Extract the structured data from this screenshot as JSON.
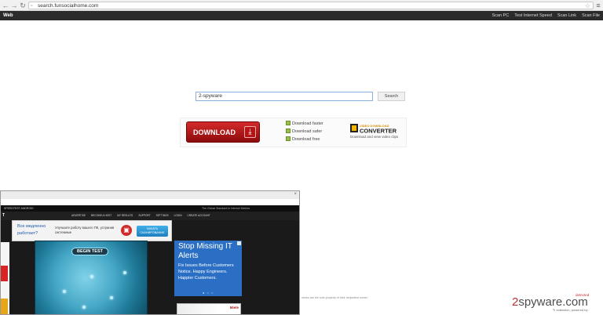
{
  "browser": {
    "url": "search.funsocialhome.com",
    "back_icon": "back-arrow-icon",
    "forward_icon": "forward-arrow-icon",
    "reload_icon": "reload-icon",
    "star_icon": "star-icon",
    "menu_icon": "menu-icon"
  },
  "header": {
    "brand": "Web",
    "links": [
      "Scan PC",
      "Test Internet Speed",
      "Scan Link",
      "Scan File"
    ]
  },
  "search": {
    "value": "2-spyware",
    "button": "Search"
  },
  "ad": {
    "download_label": "DOWNLOAD",
    "features": [
      "Download faster",
      "Download safer",
      "Download free"
    ],
    "logo_top": "VIDEO DOWNLOAD",
    "logo_main": "CONVERTER",
    "logo_caption": "Download and view video clips"
  },
  "inner": {
    "top_left": "SPEEDTEST   ANDROID",
    "top_right": "The Global Standard in Internet Metrics",
    "nav_title": "T",
    "nav_links": [
      "ADVERTISE",
      "BECOME A HOST",
      "MY RESULTS",
      "SUPPORT",
      "SETTINGS",
      "LOGIN",
      "CREATE ACCOUNT"
    ],
    "russian": {
      "question": "Все медленно работает?",
      "text": "Улучшите работу вашего ПК, устранив системные",
      "button": "НАЧАТЬ СКАНИРОВАНИЕ"
    },
    "begin_test": "BEGIN TEST",
    "right_ad": {
      "title": "Stop Missing IT Alerts",
      "body": "Fix Issues Before Customers Notice. Happy Engineers. Happier Customers."
    },
    "miele": "Miele"
  },
  "footer": {
    "note": "stores are the sole property of their respective owner",
    "watermark_prefix": "2",
    "watermark_main": "spyware.com",
    "detected": "detected",
    "bottom_right": "✎ extension, powered by"
  }
}
